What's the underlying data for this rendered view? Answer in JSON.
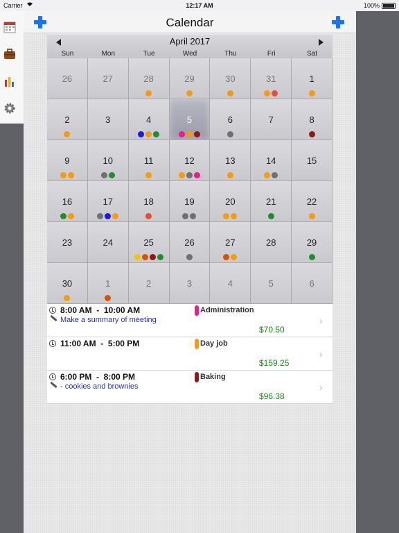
{
  "status_bar": {
    "carrier": "Carrier",
    "time": "12:17 AM",
    "battery": "100%"
  },
  "nav": {
    "title": "Calendar"
  },
  "calendar": {
    "month": "April 2017",
    "weekdays": [
      "Sun",
      "Mon",
      "Tue",
      "Wed",
      "Thu",
      "Fri",
      "Sat"
    ],
    "days": [
      {
        "n": "26",
        "other": true,
        "dots": []
      },
      {
        "n": "27",
        "other": true,
        "dots": []
      },
      {
        "n": "28",
        "other": true,
        "dots": [
          "#f39c12"
        ]
      },
      {
        "n": "29",
        "other": true,
        "dots": [
          "#f39c12"
        ]
      },
      {
        "n": "30",
        "other": true,
        "dots": [
          "#f39c12"
        ]
      },
      {
        "n": "31",
        "other": true,
        "dots": [
          "#f39c12",
          "#e74c3c"
        ]
      },
      {
        "n": "1",
        "other": false,
        "dots": [
          "#f39c12"
        ]
      },
      {
        "n": "2",
        "other": false,
        "dots": [
          "#f39c12"
        ]
      },
      {
        "n": "3",
        "other": false,
        "dots": []
      },
      {
        "n": "4",
        "other": false,
        "dots": [
          "#1a1af0",
          "#f39c12",
          "#1e8e2e"
        ]
      },
      {
        "n": "5",
        "other": false,
        "today": true,
        "dots": [
          "#e91e8c",
          "#f39c12",
          "#8b1a1a"
        ]
      },
      {
        "n": "6",
        "other": false,
        "dots": [
          "#707070"
        ]
      },
      {
        "n": "7",
        "other": false,
        "dots": []
      },
      {
        "n": "8",
        "other": false,
        "dots": [
          "#8b1a1a"
        ]
      },
      {
        "n": "9",
        "other": false,
        "dots": [
          "#f39c12",
          "#f39c12"
        ]
      },
      {
        "n": "10",
        "other": false,
        "dots": [
          "#707070",
          "#1e8e2e"
        ]
      },
      {
        "n": "11",
        "other": false,
        "dots": [
          "#f39c12"
        ]
      },
      {
        "n": "12",
        "other": false,
        "dots": [
          "#f39c12",
          "#707070",
          "#e91e8c"
        ]
      },
      {
        "n": "13",
        "other": false,
        "dots": [
          "#f39c12"
        ]
      },
      {
        "n": "14",
        "other": false,
        "dots": [
          "#f39c12",
          "#707070"
        ]
      },
      {
        "n": "15",
        "other": false,
        "dots": []
      },
      {
        "n": "16",
        "other": false,
        "dots": [
          "#1e8e2e",
          "#f39c12"
        ]
      },
      {
        "n": "17",
        "other": false,
        "dots": [
          "#707070",
          "#1a1af0",
          "#f39c12"
        ]
      },
      {
        "n": "18",
        "other": false,
        "dots": [
          "#e74c3c"
        ]
      },
      {
        "n": "19",
        "other": false,
        "dots": [
          "#707070",
          "#707070"
        ]
      },
      {
        "n": "20",
        "other": false,
        "dots": [
          "#f39c12",
          "#f39c12"
        ]
      },
      {
        "n": "21",
        "other": false,
        "dots": [
          "#1e8e2e"
        ]
      },
      {
        "n": "22",
        "other": false,
        "dots": [
          "#f39c12"
        ]
      },
      {
        "n": "23",
        "other": false,
        "dots": []
      },
      {
        "n": "24",
        "other": false,
        "dots": []
      },
      {
        "n": "25",
        "other": false,
        "dots": [
          "#f1c40f",
          "#d35400",
          "#8b1a1a",
          "#1e8e2e"
        ]
      },
      {
        "n": "26",
        "other": false,
        "dots": [
          "#707070"
        ]
      },
      {
        "n": "27",
        "other": false,
        "dots": [
          "#d35400",
          "#f39c12"
        ]
      },
      {
        "n": "28",
        "other": false,
        "dots": []
      },
      {
        "n": "29",
        "other": false,
        "dots": [
          "#1e8e2e"
        ]
      },
      {
        "n": "30",
        "other": false,
        "dots": [
          "#f39c12"
        ]
      },
      {
        "n": "1",
        "other": true,
        "dots": [
          "#d35400"
        ]
      },
      {
        "n": "2",
        "other": true,
        "dots": []
      },
      {
        "n": "3",
        "other": true,
        "dots": []
      },
      {
        "n": "4",
        "other": true,
        "dots": []
      },
      {
        "n": "5",
        "other": true,
        "dots": []
      },
      {
        "n": "6",
        "other": true,
        "dots": []
      }
    ]
  },
  "events": [
    {
      "time": "8:00 AM  -  10:00 AM",
      "note": "Make a summary of meeting",
      "category": "Administration",
      "category_color": "#e91e8c",
      "amount": "$70.50"
    },
    {
      "time": "11:00 AM  -  5:00 PM",
      "note": "",
      "category": "Day job",
      "category_color": "#f39c12",
      "amount": "$159.25"
    },
    {
      "time": "6:00 PM  -  8:00 PM",
      "note": "- cookies and brownies",
      "category": "Baking",
      "category_color": "#8b1a1a",
      "amount": "$96.38"
    }
  ],
  "icons": {
    "side_menu": [
      "calendar-icon",
      "briefcase-icon",
      "bar-chart-icon",
      "gear-icon"
    ],
    "nav": [
      "add-icon",
      "add-icon"
    ],
    "calendar": [
      "chevron-left-icon",
      "chevron-right-icon"
    ],
    "events": [
      "clock-icon",
      "pencil-icon",
      "chevron-right-icon"
    ]
  }
}
